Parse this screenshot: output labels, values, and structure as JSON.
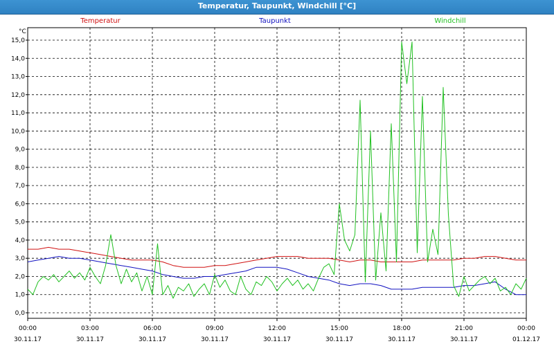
{
  "window": {
    "title": "Temperatur, Taupunkt, Windchill [°C]"
  },
  "chart_data": {
    "type": "line",
    "unit": "°C",
    "ylim": [
      0,
      15
    ],
    "y_ticks": [
      "0,0",
      "1,0",
      "2,0",
      "3,0",
      "4,0",
      "5,0",
      "6,0",
      "7,0",
      "8,0",
      "9,0",
      "10,0",
      "11,0",
      "12,0",
      "13,0",
      "14,0",
      "15,0"
    ],
    "x_ticks": [
      {
        "time": "00:00",
        "date": "30.11.17"
      },
      {
        "time": "03:00",
        "date": "30.11.17"
      },
      {
        "time": "06:00",
        "date": "30.11.17"
      },
      {
        "time": "09:00",
        "date": "30.11.17"
      },
      {
        "time": "12:00",
        "date": "30.11.17"
      },
      {
        "time": "15:00",
        "date": "30.11.17"
      },
      {
        "time": "18:00",
        "date": "30.11.17"
      },
      {
        "time": "21:00",
        "date": "30.11.17"
      },
      {
        "time": "00:00",
        "date": "01.12.17"
      }
    ],
    "grid": true,
    "legend_placement": "top",
    "series": [
      {
        "name": "Temperatur",
        "color": "#d01010",
        "x": [
          0,
          0.5,
          1,
          1.5,
          2,
          2.5,
          3,
          3.5,
          4,
          4.5,
          5,
          5.5,
          6,
          6.5,
          7,
          7.5,
          8,
          8.5,
          9,
          9.5,
          10,
          10.5,
          11,
          11.5,
          12,
          12.5,
          13,
          13.5,
          14,
          14.5,
          15,
          15.5,
          16,
          16.5,
          17,
          17.5,
          18,
          18.5,
          19,
          19.5,
          20,
          20.5,
          21,
          21.5,
          22,
          22.5,
          23,
          23.5,
          24
        ],
        "y": [
          3.5,
          3.5,
          3.6,
          3.5,
          3.5,
          3.4,
          3.3,
          3.2,
          3.1,
          3.0,
          2.9,
          2.9,
          2.9,
          2.8,
          2.6,
          2.5,
          2.5,
          2.5,
          2.6,
          2.6,
          2.7,
          2.8,
          2.9,
          3.0,
          3.1,
          3.1,
          3.1,
          3.0,
          3.0,
          3.0,
          2.9,
          2.8,
          2.9,
          2.9,
          2.8,
          2.8,
          2.8,
          2.8,
          2.9,
          2.9,
          2.9,
          2.9,
          3.0,
          3.0,
          3.1,
          3.1,
          3.0,
          2.9,
          2.9
        ]
      },
      {
        "name": "Taupunkt",
        "color": "#1010c0",
        "x": [
          0,
          0.5,
          1,
          1.5,
          2,
          2.5,
          3,
          3.5,
          4,
          4.5,
          5,
          5.5,
          6,
          6.5,
          7,
          7.5,
          8,
          8.5,
          9,
          9.5,
          10,
          10.5,
          11,
          11.5,
          12,
          12.5,
          13,
          13.5,
          14,
          14.5,
          15,
          15.5,
          16,
          16.5,
          17,
          17.5,
          18,
          18.5,
          19,
          19.5,
          20,
          20.5,
          21,
          21.5,
          22,
          22.5,
          23,
          23.5,
          24
        ],
        "y": [
          2.8,
          2.9,
          3.0,
          3.1,
          3.0,
          3.0,
          2.9,
          2.8,
          2.7,
          2.6,
          2.5,
          2.4,
          2.3,
          2.1,
          2.0,
          1.9,
          1.9,
          2.0,
          2.0,
          2.1,
          2.2,
          2.3,
          2.5,
          2.5,
          2.5,
          2.4,
          2.2,
          2.0,
          1.9,
          1.8,
          1.6,
          1.5,
          1.6,
          1.6,
          1.5,
          1.3,
          1.3,
          1.3,
          1.4,
          1.4,
          1.4,
          1.4,
          1.5,
          1.5,
          1.6,
          1.7,
          1.3,
          1.0,
          1.0
        ]
      },
      {
        "name": "Windchill",
        "color": "#20c020",
        "x": [
          0,
          0.25,
          0.5,
          0.75,
          1,
          1.25,
          1.5,
          1.75,
          2,
          2.25,
          2.5,
          2.75,
          3,
          3.25,
          3.5,
          3.75,
          4,
          4.25,
          4.5,
          4.75,
          5,
          5.25,
          5.5,
          5.75,
          6,
          6.25,
          6.5,
          6.75,
          7,
          7.25,
          7.5,
          7.75,
          8,
          8.25,
          8.5,
          8.75,
          9,
          9.25,
          9.5,
          9.75,
          10,
          10.25,
          10.5,
          10.75,
          11,
          11.25,
          11.5,
          11.75,
          12,
          12.25,
          12.5,
          12.75,
          13,
          13.25,
          13.5,
          13.75,
          14,
          14.25,
          14.5,
          14.75,
          15,
          15.25,
          15.5,
          15.75,
          16,
          16.25,
          16.5,
          16.75,
          17,
          17.25,
          17.5,
          17.75,
          18,
          18.25,
          18.5,
          18.75,
          19,
          19.25,
          19.5,
          19.75,
          20,
          20.25,
          20.5,
          20.75,
          21,
          21.25,
          21.5,
          21.75,
          22,
          22.25,
          22.5,
          22.75,
          23,
          23.25,
          23.5,
          23.75,
          24
        ],
        "y": [
          1.3,
          1.0,
          1.7,
          2.0,
          1.8,
          2.1,
          1.7,
          2.0,
          2.3,
          1.9,
          2.2,
          1.8,
          2.5,
          2.0,
          1.6,
          2.6,
          4.3,
          2.6,
          1.6,
          2.4,
          1.7,
          2.2,
          1.2,
          2.0,
          1.0,
          3.8,
          1.0,
          1.5,
          0.8,
          1.4,
          1.2,
          1.6,
          0.9,
          1.3,
          1.6,
          1.0,
          2.1,
          1.4,
          1.8,
          1.2,
          1.0,
          2.0,
          1.3,
          1.0,
          1.7,
          1.5,
          2.0,
          1.7,
          1.2,
          1.6,
          1.9,
          1.5,
          1.8,
          1.3,
          1.6,
          1.2,
          1.9,
          2.5,
          2.7,
          2.1,
          6.0,
          4.0,
          3.4,
          4.3,
          11.7,
          1.7,
          10.0,
          1.8,
          5.5,
          2.3,
          10.4,
          2.8,
          14.9,
          12.6,
          14.9,
          3.3,
          11.9,
          2.8,
          4.6,
          3.2,
          12.4,
          5.4,
          1.5,
          0.9,
          2.0,
          1.2,
          1.5,
          1.8,
          2.0,
          1.6,
          1.9,
          1.2,
          1.4,
          1.0,
          1.6,
          1.3,
          1.9
        ]
      }
    ]
  }
}
